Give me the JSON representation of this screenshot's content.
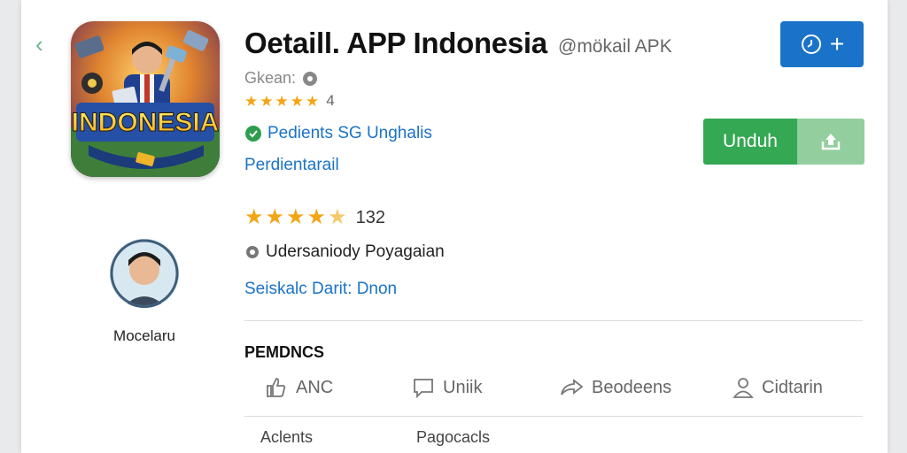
{
  "app": {
    "title": "Oetaill. APP Indonesia",
    "tag": "@mökail APK",
    "developer": "Gkean:",
    "small_rating": "4",
    "link_green": "Pedients SG Unghalis",
    "link_blue": "Perdientarail",
    "rating_count": "132",
    "publisher": "Udersaniody Poyagaian",
    "see_more": "Seiskalc Darit: Dnon",
    "icon_banner_text": "INDONESIA"
  },
  "buttons": {
    "download_label": "Unduh",
    "small_button_plus": "+"
  },
  "profile": {
    "name": "Mocelaru"
  },
  "section": {
    "title": "PEMDNCS",
    "actions": [
      {
        "label": "ANC",
        "icon": "thumbs-up-icon"
      },
      {
        "label": "Uniik",
        "icon": "comment-icon"
      },
      {
        "label": "Beodeens",
        "icon": "share-icon"
      },
      {
        "label": "Cidtarin",
        "icon": "user-icon"
      }
    ],
    "bottom": [
      {
        "label": "Aclents"
      },
      {
        "label": "Pagocacls"
      }
    ]
  },
  "colors": {
    "accent_blue": "#1a73c8",
    "download_green": "#34a853",
    "download_green_light": "#93cf9e",
    "star": "#f2a516"
  }
}
